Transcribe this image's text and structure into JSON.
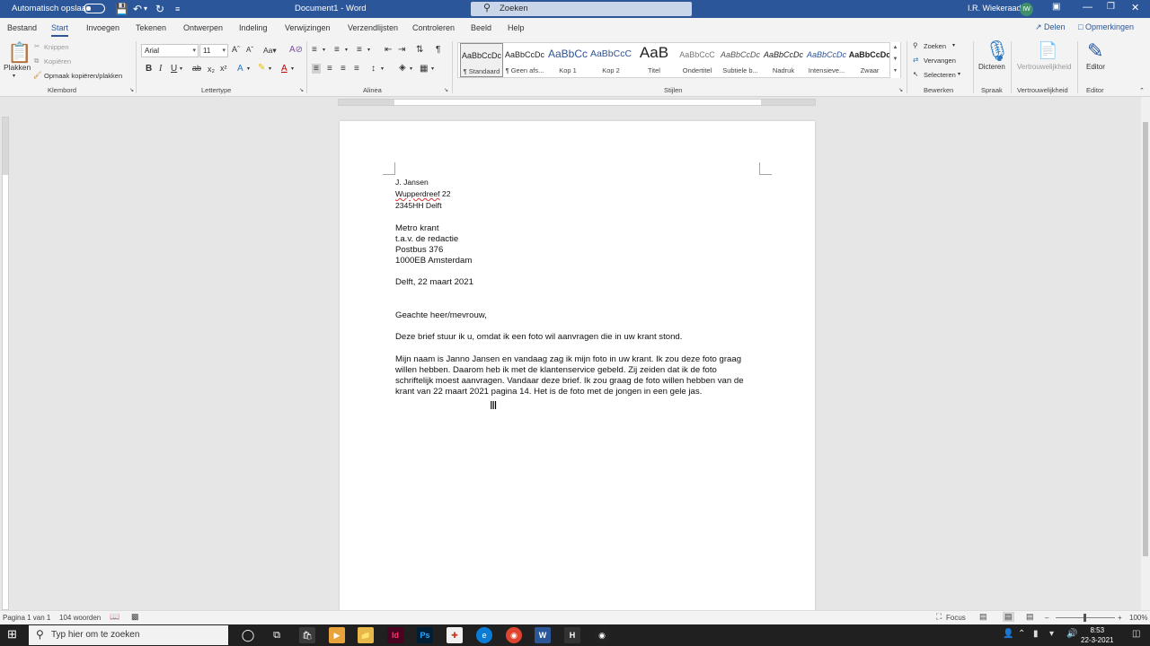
{
  "titlebar": {
    "autosave_label": "Automatisch opslaan",
    "document_title": "Document1  -  Word",
    "search_placeholder": "Zoeken",
    "user_name": "I.R. Wiekeraad",
    "user_initials": "IW",
    "accent_color": "#2b579a"
  },
  "tabs": [
    "Bestand",
    "Start",
    "Invoegen",
    "Tekenen",
    "Ontwerpen",
    "Indeling",
    "Verwijzingen",
    "Verzendlijsten",
    "Controleren",
    "Beeld",
    "Help"
  ],
  "active_tab": "Start",
  "share_label": "Delen",
  "comments_label": "Opmerkingen",
  "ribbon": {
    "clipboard": {
      "paste": "Plakken",
      "cut": "Knippen",
      "copy": "Kopiëren",
      "format_painter": "Opmaak kopiëren/plakken",
      "group": "Klembord"
    },
    "font": {
      "name": "Arial",
      "size": "11",
      "group": "Lettertype"
    },
    "paragraph_group": "Alinea",
    "styles": {
      "group": "Stijlen",
      "items": [
        {
          "preview": "AaBbCcDc",
          "name": "¶ Standaard"
        },
        {
          "preview": "AaBbCcDc",
          "name": "¶ Geen afs..."
        },
        {
          "preview": "AaBbCc",
          "name": "Kop 1"
        },
        {
          "preview": "AaBbCcC",
          "name": "Kop 2"
        },
        {
          "preview": "AaB",
          "name": "Titel"
        },
        {
          "preview": "AaBbCcC",
          "name": "Ondertitel"
        },
        {
          "preview": "AaBbCcDc",
          "name": "Subtiele b..."
        },
        {
          "preview": "AaBbCcDc",
          "name": "Nadruk"
        },
        {
          "preview": "AaBbCcDc",
          "name": "Intensieve..."
        },
        {
          "preview": "AaBbCcDc",
          "name": "Zwaar"
        }
      ]
    },
    "editing": {
      "find": "Zoeken",
      "replace": "Vervangen",
      "select": "Selecteren",
      "group": "Bewerken"
    },
    "voice": {
      "dictate": "Dicteren",
      "group": "Spraak"
    },
    "sensitivity": {
      "label": "Vertrouwelijkheid",
      "group": "Vertrouwelijkheid"
    },
    "editor": {
      "label": "Editor",
      "group": "Editor"
    }
  },
  "document": {
    "sender_name": "J. Jansen",
    "sender_street": "Wupperdreef",
    "sender_number": " 22",
    "sender_city": "2345HH Delft",
    "recipient": [
      "Metro krant",
      "t.a.v. de redactie",
      "Postbus 376",
      "1000EB Amsterdam"
    ],
    "date_line": "Delft, 22 maart 2021",
    "salutation": "Geachte heer/mevrouw,",
    "intro": "Deze brief stuur ik u, omdat ik een foto wil aanvragen die in uw krant stond.",
    "body_lines": [
      "Mijn naam is Janno Jansen en vandaag zag ik mijn foto in uw krant. Ik zou deze foto graag",
      "willen hebben. Daarom heb ik met de klantenservice gebeld. Zij zeiden dat ik de foto",
      "schriftelijk moest aanvragen. Vandaar deze brief. Ik zou graag de foto willen hebben van de",
      "krant van 22 maart 2021 pagina 14. Het is de foto met de jongen in een gele jas."
    ]
  },
  "statusbar": {
    "page": "Pagina 1 van 1",
    "words": "104 woorden",
    "focus": "Focus",
    "zoom": "100%",
    "zoom_level": 1.0
  },
  "taskbar": {
    "search_placeholder": "Typ hier om te zoeken",
    "time": "8:53",
    "date": "22-3-2021"
  }
}
